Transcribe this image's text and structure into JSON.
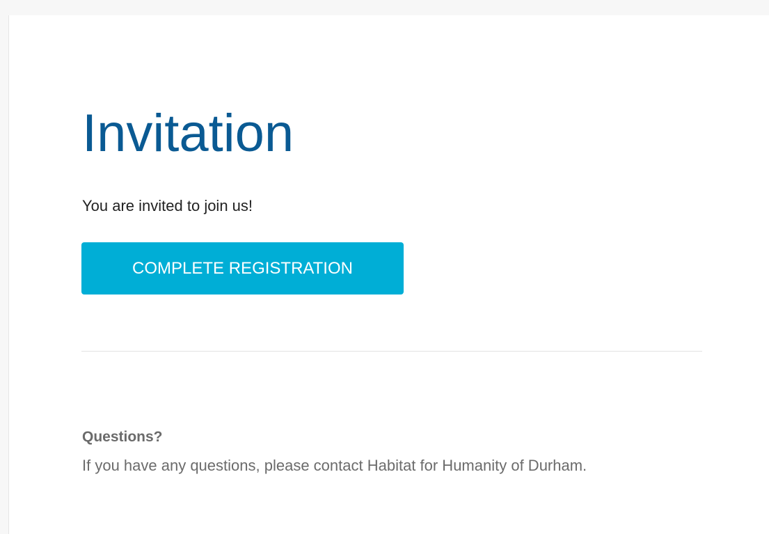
{
  "email": {
    "title": "Invitation",
    "intro": "You are invited to join us!",
    "cta_label": "COMPLETE REGISTRATION",
    "questions_heading": "Questions?",
    "questions_body": "If you have any questions, please contact Habitat for Humanity of Durham."
  },
  "colors": {
    "title": "#0a5a93",
    "cta_background": "#00aed6",
    "muted_text": "#6b6b6b"
  }
}
